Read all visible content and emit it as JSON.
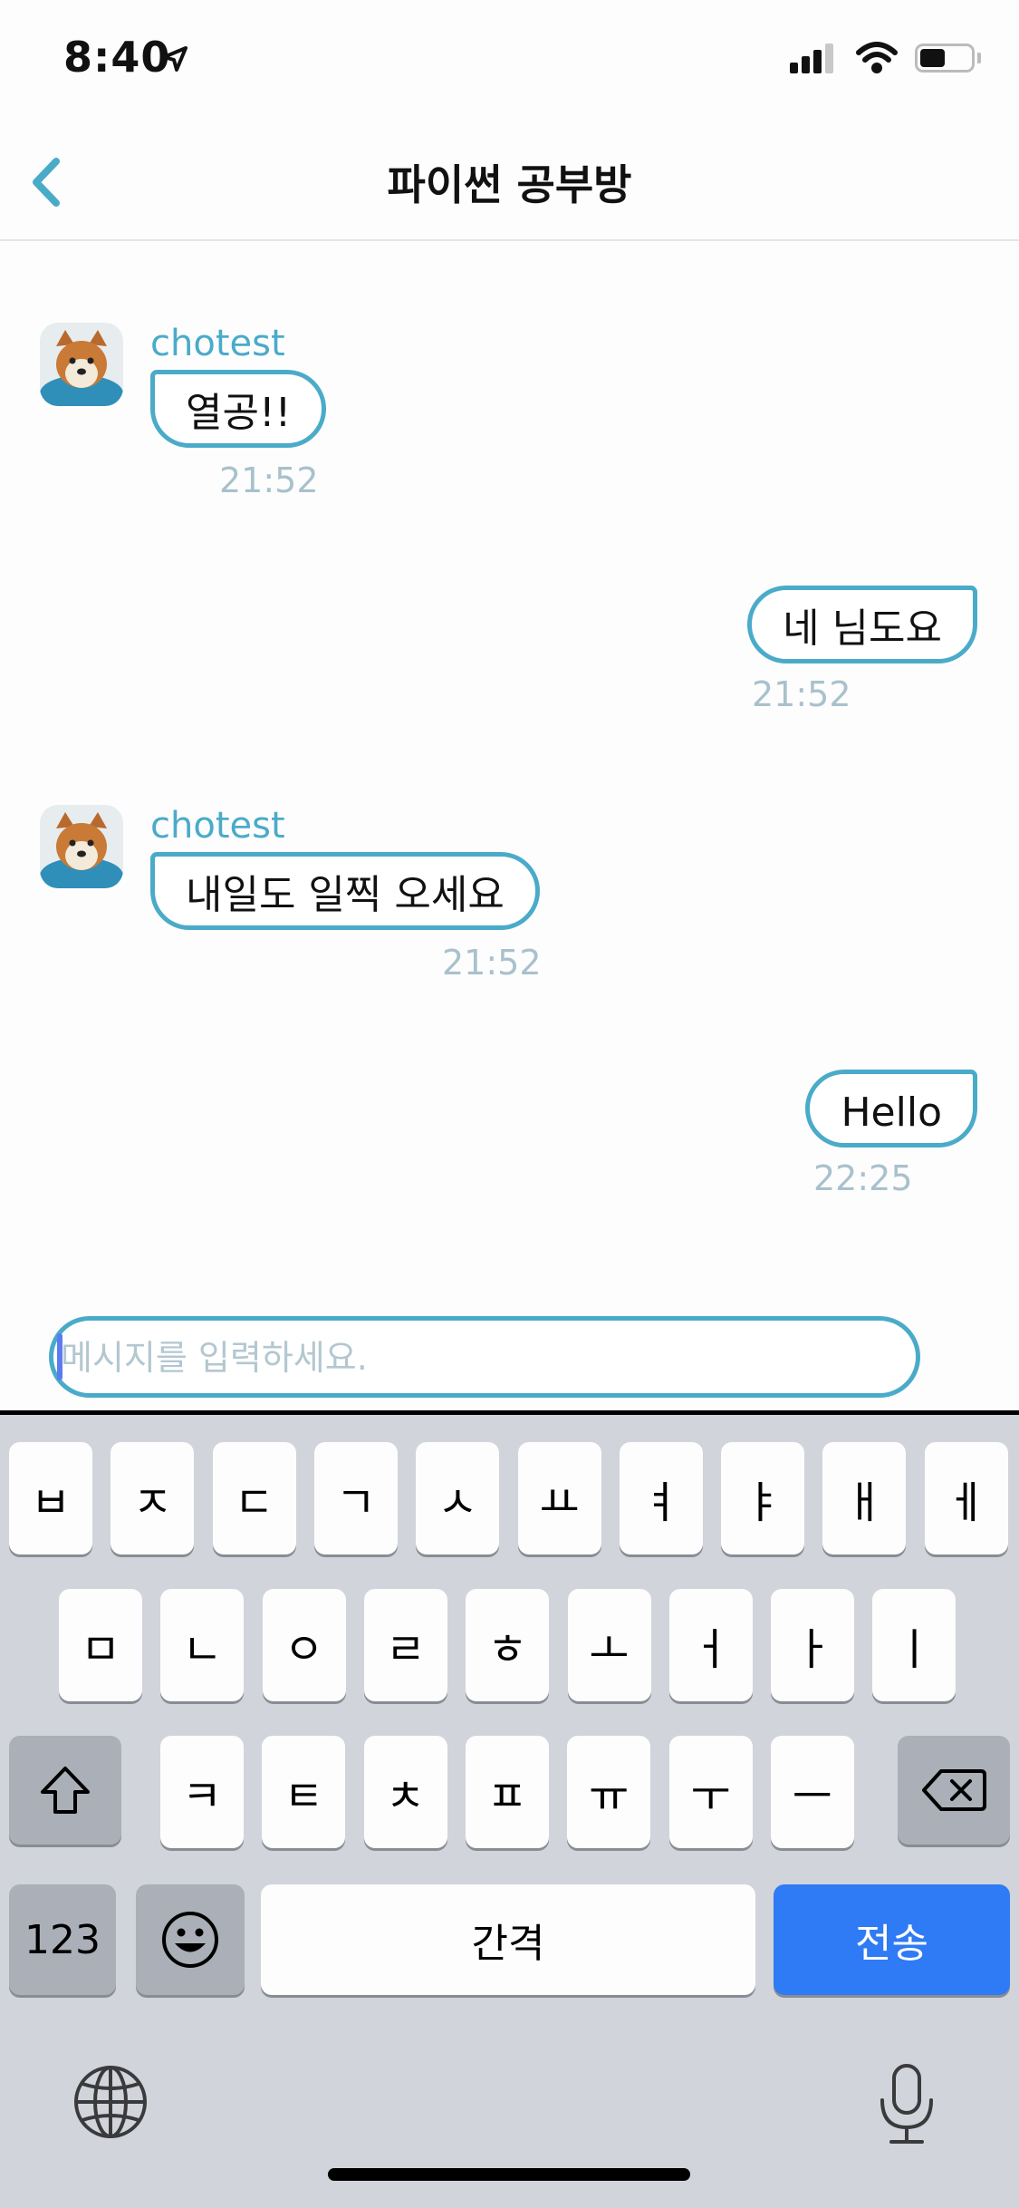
{
  "status_bar": {
    "time": "8:40",
    "battery_level": 0.5
  },
  "header": {
    "title": "파이썬 공부방",
    "back_icon": "chevron-left-icon"
  },
  "colors": {
    "accent": "#4aabc9",
    "send_key": "#2f7af5",
    "timestamp": "#a8c1cc"
  },
  "messages": [
    {
      "direction": "incoming",
      "sender": "chotest",
      "text": "열공!!",
      "time": "21:52"
    },
    {
      "direction": "outgoing",
      "text": "네 님도요",
      "time": "21:52"
    },
    {
      "direction": "incoming",
      "sender": "chotest",
      "text": "내일도 일찍 오세요",
      "time": "21:52"
    },
    {
      "direction": "outgoing",
      "text": "Hello",
      "time": "22:25"
    }
  ],
  "composer": {
    "value": "",
    "placeholder": "메시지를 입력하세요."
  },
  "keyboard": {
    "row1": [
      "ㅂ",
      "ㅈ",
      "ㄷ",
      "ㄱ",
      "ㅅ",
      "ㅛ",
      "ㅕ",
      "ㅑ",
      "ㅐ",
      "ㅔ"
    ],
    "row2": [
      "ㅁ",
      "ㄴ",
      "ㅇ",
      "ㄹ",
      "ㅎ",
      "ㅗ",
      "ㅓ",
      "ㅏ",
      "ㅣ"
    ],
    "row3": [
      "ㅋ",
      "ㅌ",
      "ㅊ",
      "ㅍ",
      "ㅠ",
      "ㅜ",
      "ㅡ"
    ],
    "numbers_label": "123",
    "space_label": "간격",
    "send_label": "전송",
    "icons": {
      "shift": "shift-icon",
      "delete": "backspace-icon",
      "emoji": "emoji-icon",
      "globe": "globe-icon",
      "mic": "microphone-icon"
    }
  }
}
